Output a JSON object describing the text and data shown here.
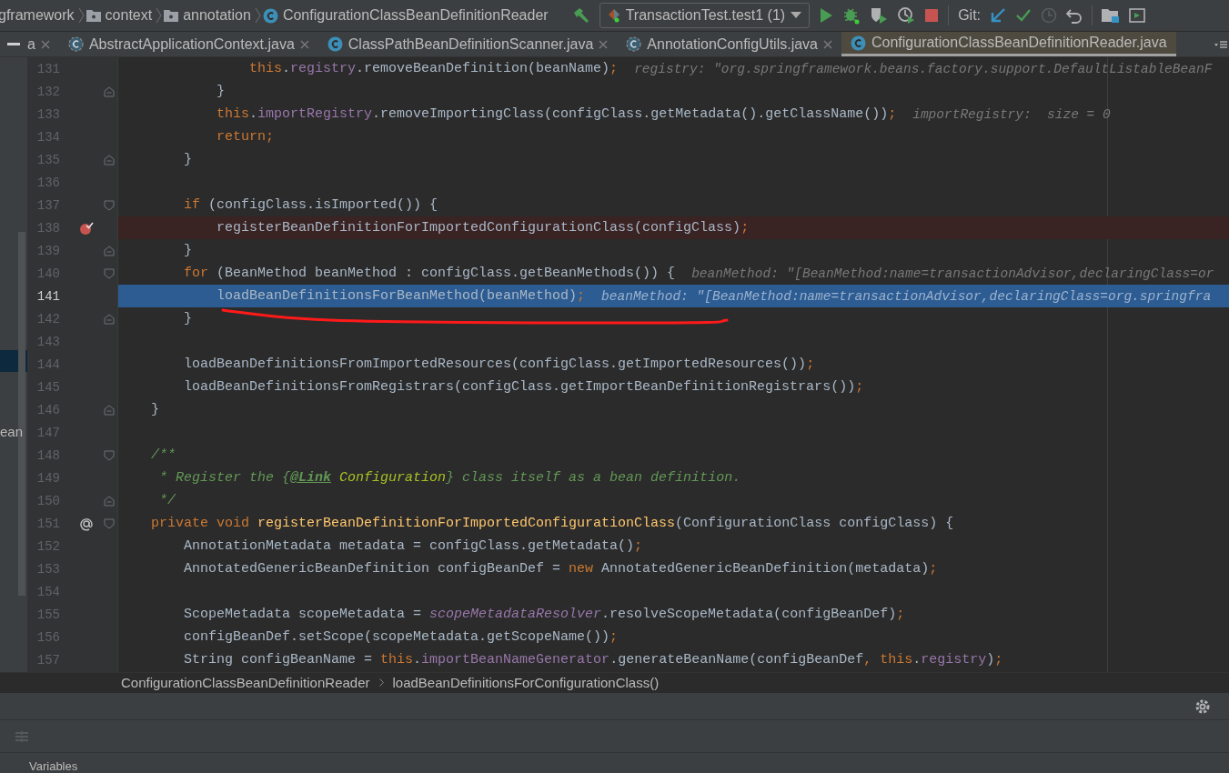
{
  "nav_bar": {
    "path": [
      {
        "label": "gframework",
        "kind": "package"
      },
      {
        "label": "context",
        "kind": "folder"
      },
      {
        "label": "annotation",
        "kind": "folder"
      },
      {
        "label": "ConfigurationClassBeanDefinitionReader",
        "kind": "class"
      }
    ],
    "run_config": "TransactionTest.test1 (1)",
    "vcs_label": "Git:"
  },
  "tabs": [
    {
      "label": "a",
      "kind": "partial",
      "selected": false
    },
    {
      "label": "AbstractApplicationContext.java",
      "kind": "abstract",
      "selected": false
    },
    {
      "label": "ClassPathBeanDefinitionScanner.java",
      "kind": "class",
      "selected": false
    },
    {
      "label": "AnnotationConfigUtils.java",
      "kind": "abstract",
      "selected": false
    },
    {
      "label": "ConfigurationClassBeanDefinitionReader.java",
      "kind": "class",
      "selected": true
    }
  ],
  "left_panel": {
    "text": "ean"
  },
  "editor": {
    "lines": [
      {
        "number": "131",
        "breakpoint": false,
        "override_mark": false,
        "fold_start": false,
        "fold_end": false,
        "execution_point": false,
        "segments": [
          {
            "kind": "keyword",
            "text": "                this"
          },
          {
            "kind": "plain",
            "text": "."
          },
          {
            "kind": "field",
            "text": "registry"
          },
          {
            "kind": "plain",
            "text": ".removeBeanDefinition(beanName)"
          },
          {
            "kind": "keyword",
            "text": ";"
          }
        ],
        "hint": "registry: \"org.springframework.beans.factory.support.DefaultListableBeanF"
      },
      {
        "number": "132",
        "breakpoint": false,
        "override_mark": false,
        "fold_start": false,
        "fold_end": true,
        "execution_point": false,
        "segments": [
          {
            "kind": "plain",
            "text": "            }"
          }
        ]
      },
      {
        "number": "133",
        "breakpoint": false,
        "override_mark": false,
        "fold_start": false,
        "fold_end": false,
        "execution_point": false,
        "segments": [
          {
            "kind": "keyword",
            "text": "            this"
          },
          {
            "kind": "plain",
            "text": "."
          },
          {
            "kind": "field",
            "text": "importRegistry"
          },
          {
            "kind": "plain",
            "text": ".removeImportingClass(configClass.getMetadata().getClassName())"
          },
          {
            "kind": "keyword",
            "text": ";"
          }
        ],
        "hint": "importRegistry:  size = 0"
      },
      {
        "number": "134",
        "breakpoint": false,
        "override_mark": false,
        "fold_start": false,
        "fold_end": false,
        "execution_point": false,
        "segments": [
          {
            "kind": "keyword",
            "text": "            return;"
          }
        ]
      },
      {
        "number": "135",
        "breakpoint": false,
        "override_mark": false,
        "fold_start": false,
        "fold_end": true,
        "execution_point": false,
        "segments": [
          {
            "kind": "plain",
            "text": "        }"
          }
        ]
      },
      {
        "number": "136",
        "breakpoint": false,
        "override_mark": false,
        "fold_start": false,
        "fold_end": false,
        "execution_point": false
      },
      {
        "number": "137",
        "breakpoint": false,
        "override_mark": false,
        "fold_start": true,
        "fold_end": false,
        "execution_point": false,
        "segments": [
          {
            "kind": "keyword",
            "text": "        if"
          },
          {
            "kind": "plain",
            "text": " (configClass.isImported()) {"
          }
        ]
      },
      {
        "number": "138",
        "breakpoint": true,
        "override_mark": false,
        "fold_start": false,
        "fold_end": false,
        "execution_point": false,
        "segments": [
          {
            "kind": "plain",
            "text": "            registerBeanDefinitionForImportedConfigurationClass(configClass)"
          },
          {
            "kind": "keyword",
            "text": ";"
          }
        ]
      },
      {
        "number": "139",
        "breakpoint": false,
        "override_mark": false,
        "fold_start": false,
        "fold_end": true,
        "execution_point": false,
        "segments": [
          {
            "kind": "plain",
            "text": "        }"
          }
        ]
      },
      {
        "number": "140",
        "breakpoint": false,
        "override_mark": false,
        "fold_start": true,
        "fold_end": false,
        "execution_point": false,
        "segments": [
          {
            "kind": "keyword",
            "text": "        for"
          },
          {
            "kind": "plain",
            "text": " (BeanMethod beanMethod : configClass.getBeanMethods()) {"
          }
        ],
        "hint": "beanMethod: \"[BeanMethod:name=transactionAdvisor,declaringClass=or"
      },
      {
        "number": "141",
        "breakpoint": false,
        "override_mark": false,
        "fold_start": false,
        "fold_end": false,
        "execution_point": true,
        "segments": [
          {
            "kind": "plain",
            "text": "            loadBeanDefinitionsForBeanMethod(beanMethod)"
          },
          {
            "kind": "keyword",
            "text": ";"
          }
        ],
        "hint": "beanMethod: \"[BeanMethod:name=transactionAdvisor,declaringClass=org.springfra"
      },
      {
        "number": "142",
        "breakpoint": false,
        "override_mark": false,
        "fold_start": false,
        "fold_end": true,
        "execution_point": false,
        "segments": [
          {
            "kind": "plain",
            "text": "        }"
          }
        ]
      },
      {
        "number": "143",
        "breakpoint": false,
        "override_mark": false,
        "fold_start": false,
        "fold_end": false,
        "execution_point": false
      },
      {
        "number": "144",
        "breakpoint": false,
        "override_mark": false,
        "fold_start": false,
        "fold_end": false,
        "execution_point": false,
        "segments": [
          {
            "kind": "plain",
            "text": "        loadBeanDefinitionsFromImportedResources(configClass.getImportedResources())"
          },
          {
            "kind": "keyword",
            "text": ";"
          }
        ]
      },
      {
        "number": "145",
        "breakpoint": false,
        "override_mark": false,
        "fold_start": false,
        "fold_end": false,
        "execution_point": false,
        "segments": [
          {
            "kind": "plain",
            "text": "        loadBeanDefinitionsFromRegistrars(configClass.getImportBeanDefinitionRegistrars())"
          },
          {
            "kind": "keyword",
            "text": ";"
          }
        ]
      },
      {
        "number": "146",
        "breakpoint": false,
        "override_mark": false,
        "fold_start": false,
        "fold_end": true,
        "execution_point": false,
        "segments": [
          {
            "kind": "plain",
            "text": "    }"
          }
        ]
      },
      {
        "number": "147",
        "breakpoint": false,
        "override_mark": false,
        "fold_start": false,
        "fold_end": false,
        "execution_point": false
      },
      {
        "number": "148",
        "breakpoint": false,
        "override_mark": false,
        "fold_start": true,
        "fold_end": false,
        "execution_point": false,
        "segments": [
          {
            "kind": "doc",
            "text": "    /**"
          }
        ]
      },
      {
        "number": "149",
        "breakpoint": false,
        "override_mark": false,
        "fold_start": false,
        "fold_end": false,
        "execution_point": false,
        "segments": [
          {
            "kind": "doc",
            "text": "     * Register the {"
          },
          {
            "kind": "doc_tag",
            "text": "@Link"
          },
          {
            "kind": "doc_ref",
            "text": " Configuration"
          },
          {
            "kind": "doc",
            "text": "} class itself as a bean definition."
          }
        ]
      },
      {
        "number": "150",
        "breakpoint": false,
        "override_mark": false,
        "fold_start": false,
        "fold_end": true,
        "execution_point": false,
        "segments": [
          {
            "kind": "doc",
            "text": "     */"
          }
        ]
      },
      {
        "number": "151",
        "breakpoint": false,
        "override_mark": true,
        "fold_start": true,
        "fold_end": false,
        "execution_point": false,
        "segments": [
          {
            "kind": "keyword",
            "text": "    private void"
          },
          {
            "kind": "declaration",
            "text": " registerBeanDefinitionForImportedConfigurationClass"
          },
          {
            "kind": "plain",
            "text": "(ConfigurationClass configClass) {"
          }
        ]
      },
      {
        "number": "152",
        "breakpoint": false,
        "override_mark": false,
        "fold_start": false,
        "fold_end": false,
        "execution_point": false,
        "segments": [
          {
            "kind": "plain",
            "text": "        AnnotationMetadata metadata = configClass.getMetadata()"
          },
          {
            "kind": "keyword",
            "text": ";"
          }
        ]
      },
      {
        "number": "153",
        "breakpoint": false,
        "override_mark": false,
        "fold_start": false,
        "fold_end": false,
        "execution_point": false,
        "segments": [
          {
            "kind": "plain",
            "text": "        AnnotatedGenericBeanDefinition configBeanDef = "
          },
          {
            "kind": "keyword",
            "text": "new"
          },
          {
            "kind": "plain",
            "text": " AnnotatedGenericBeanDefinition(metadata)"
          },
          {
            "kind": "keyword",
            "text": ";"
          }
        ]
      },
      {
        "number": "154",
        "breakpoint": false,
        "override_mark": false,
        "fold_start": false,
        "fold_end": false,
        "execution_point": false
      },
      {
        "number": "155",
        "breakpoint": false,
        "override_mark": false,
        "fold_start": false,
        "fold_end": false,
        "execution_point": false,
        "segments": [
          {
            "kind": "plain",
            "text": "        ScopeMetadata scopeMetadata = "
          },
          {
            "kind": "static_field",
            "text": "scopeMetadataResolver"
          },
          {
            "kind": "plain",
            "text": ".resolveScopeMetadata(configBeanDef)"
          },
          {
            "kind": "keyword",
            "text": ";"
          }
        ]
      },
      {
        "number": "156",
        "breakpoint": false,
        "override_mark": false,
        "fold_start": false,
        "fold_end": false,
        "execution_point": false,
        "segments": [
          {
            "kind": "plain",
            "text": "        configBeanDef.setScope(scopeMetadata.getScopeName())"
          },
          {
            "kind": "keyword",
            "text": ";"
          }
        ]
      },
      {
        "number": "157",
        "breakpoint": false,
        "override_mark": false,
        "fold_start": false,
        "fold_end": false,
        "execution_point": false,
        "segments": [
          {
            "kind": "plain",
            "text": "        String configBeanName = "
          },
          {
            "kind": "keyword",
            "text": "this"
          },
          {
            "kind": "plain",
            "text": "."
          },
          {
            "kind": "field",
            "text": "importBeanNameGenerator"
          },
          {
            "kind": "plain",
            "text": ".generateBeanName(configBeanDef"
          },
          {
            "kind": "keyword",
            "text": ", this"
          },
          {
            "kind": "plain",
            "text": "."
          },
          {
            "kind": "field",
            "text": "registry"
          },
          {
            "kind": "plain",
            "text": ")"
          },
          {
            "kind": "keyword",
            "text": ";"
          }
        ]
      }
    ]
  },
  "breadcrumbs": [
    "ConfigurationClassBeanDefinitionReader",
    "loadBeanDefinitionsForConfigurationClass()"
  ],
  "debug_panel": {
    "tab": "Variables"
  }
}
